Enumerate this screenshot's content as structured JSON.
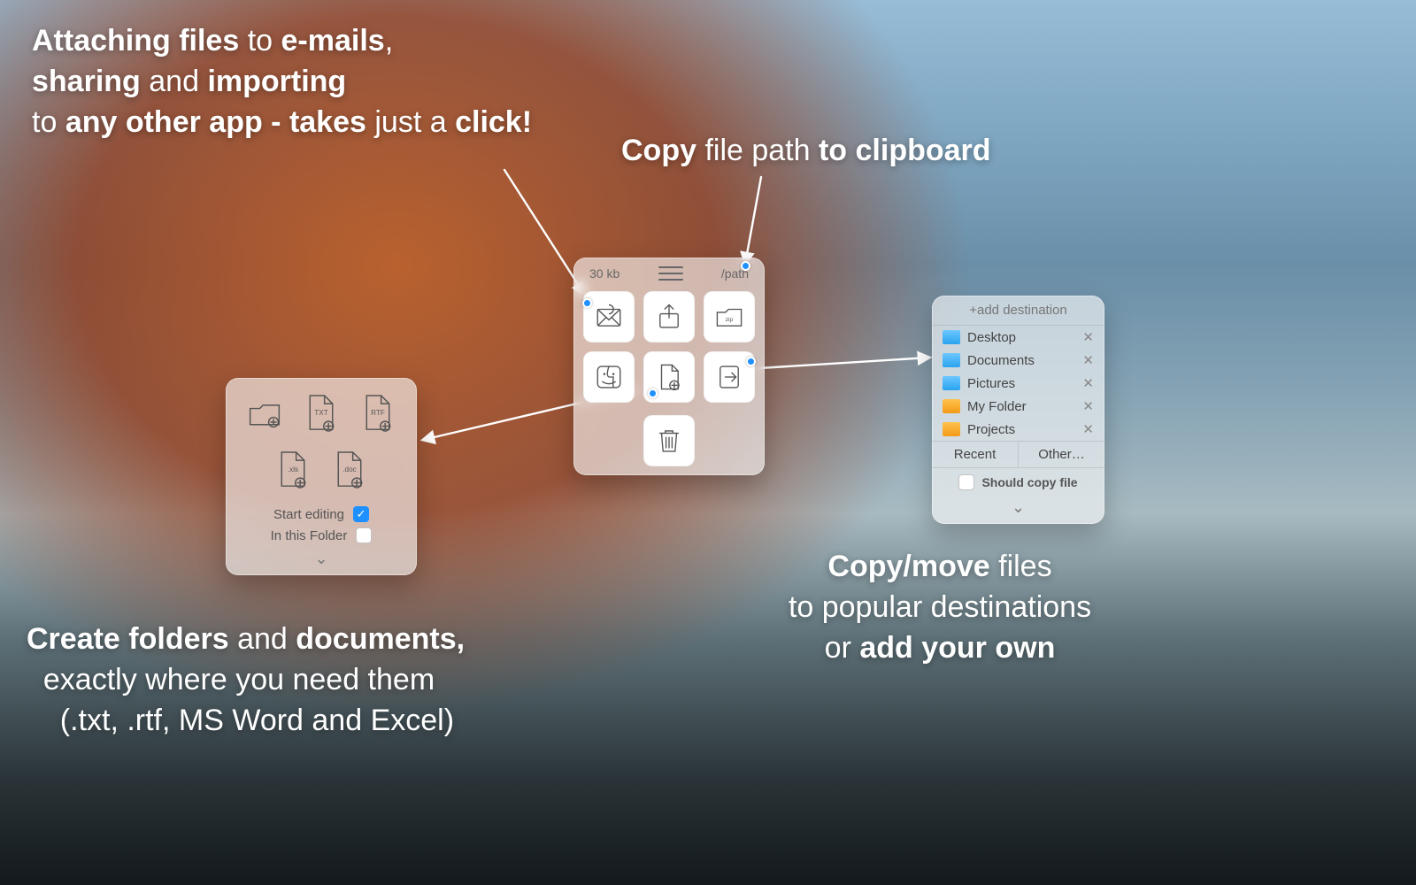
{
  "callouts": {
    "attach_html": "<b>Attaching files</b> to <b>e-mails</b>,<br><b>sharing</b> and <b>importing</b><br>to <b>any other app - takes</b> just a <b>click!</b>",
    "copy_html": "<b>Copy</b> file path <b>to clipboard</b>",
    "create_html": "<b>Create folders</b> and <b>documents,</b><br>&nbsp;&nbsp;exactly where you need them<br>&nbsp;&nbsp;&nbsp;&nbsp;(.txt, .rtf, MS Word and Excel)",
    "move_html": "<b>Copy/move</b> files<br>to popular destinations<br>or <b>add your own</b>"
  },
  "main_panel": {
    "size_label": "30 kb",
    "path_label": "/path",
    "actions": [
      {
        "name": "email-icon"
      },
      {
        "name": "share-icon"
      },
      {
        "name": "zip-icon"
      },
      {
        "name": "finder-icon"
      },
      {
        "name": "new-file-icon"
      },
      {
        "name": "move-to-icon"
      }
    ],
    "trash": {
      "name": "trash-icon"
    }
  },
  "create_panel": {
    "file_types": [
      {
        "name": "new-folder-icon",
        "label": ""
      },
      {
        "name": "new-txt-icon",
        "label": "TXT"
      },
      {
        "name": "new-rtf-icon",
        "label": "RTF"
      },
      {
        "name": "new-xls-icon",
        "label": ".xls"
      },
      {
        "name": "new-doc-icon",
        "label": ".doc"
      }
    ],
    "start_editing_label": "Start editing",
    "start_editing_checked": true,
    "in_this_folder_label": "In this Folder",
    "in_this_folder_checked": false
  },
  "dest_panel": {
    "add_label": "+add destination",
    "items": [
      {
        "label": "Desktop",
        "color": "blue"
      },
      {
        "label": "Documents",
        "color": "blue"
      },
      {
        "label": "Pictures",
        "color": "blue"
      },
      {
        "label": "My Folder",
        "color": "orange"
      },
      {
        "label": "Projects",
        "color": "orange"
      }
    ],
    "tab_recent": "Recent",
    "tab_other": "Other…",
    "should_copy_label": "Should copy file",
    "should_copy_checked": false
  }
}
